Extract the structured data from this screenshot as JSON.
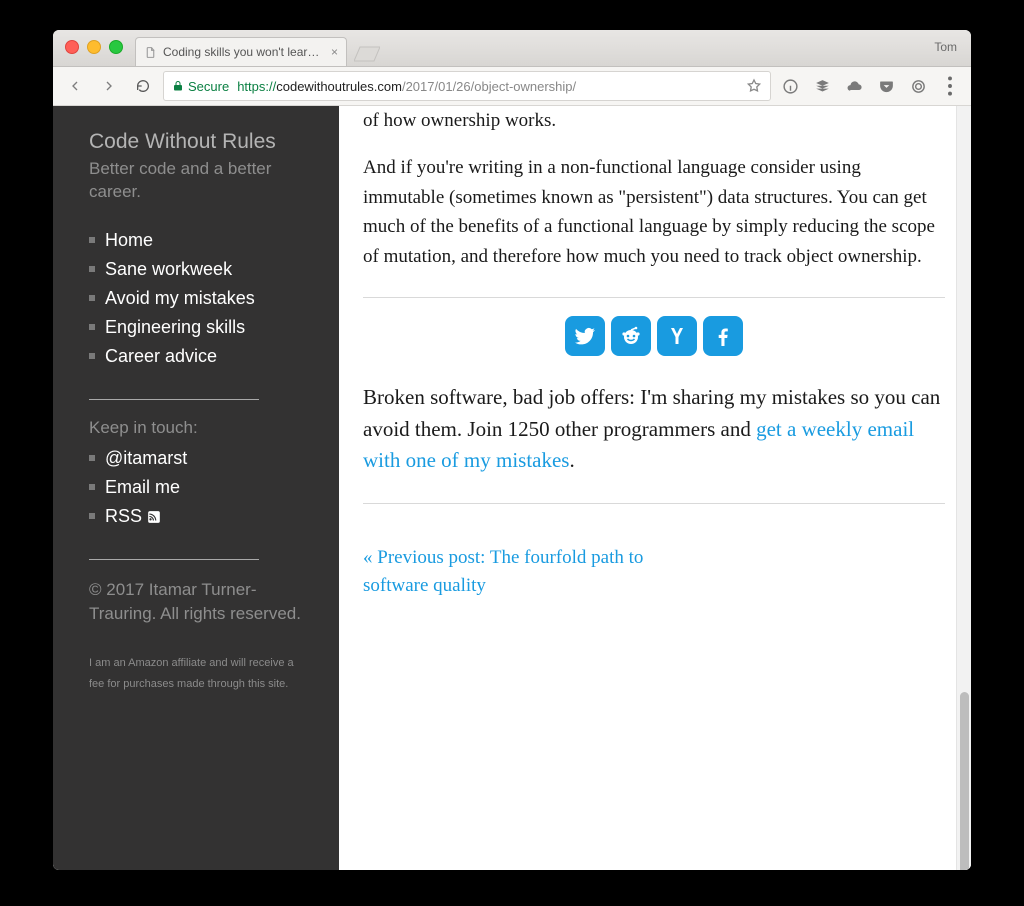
{
  "browser": {
    "profile_name": "Tom",
    "tab_title": "Coding skills you won't learn in",
    "secure_label": "Secure",
    "url": {
      "protocol": "https://",
      "host": "codewithoutrules.com",
      "path": "/2017/01/26/object-ownership/"
    }
  },
  "sidebar": {
    "brand_title": "Code Without Rules",
    "brand_sub": "Better code and a better career.",
    "nav": [
      {
        "label": "Home"
      },
      {
        "label": "Sane workweek"
      },
      {
        "label": "Avoid my mistakes"
      },
      {
        "label": "Engineering skills"
      },
      {
        "label": "Career advice"
      }
    ],
    "contact_heading": "Keep in touch:",
    "contacts": [
      {
        "label": "@itamarst"
      },
      {
        "label": "Email me"
      },
      {
        "label": "RSS"
      }
    ],
    "copyright": "© 2017 Itamar Turner-Trauring. All rights reserved.",
    "affiliate": "I am an Amazon affiliate and will receive a fee for purchases made through this site."
  },
  "article": {
    "tail_line": "of how ownership works.",
    "para2": "And if you're writing in a non-functional language consider using immutable (sometimes known as \"persistent\") data structures. You can get much of the benefits of a functional language by simply reducing the scope of mutation, and therefore how much you need to track object ownership.",
    "cta_pre": "Broken software, bad job offers: I'm sharing my mistakes so you can avoid them. Join 1250 other programmers and ",
    "cta_link": "get a weekly email with one of my mistakes",
    "cta_post": ".",
    "prev_label": "« Previous post: The fourfold path to software quality"
  }
}
